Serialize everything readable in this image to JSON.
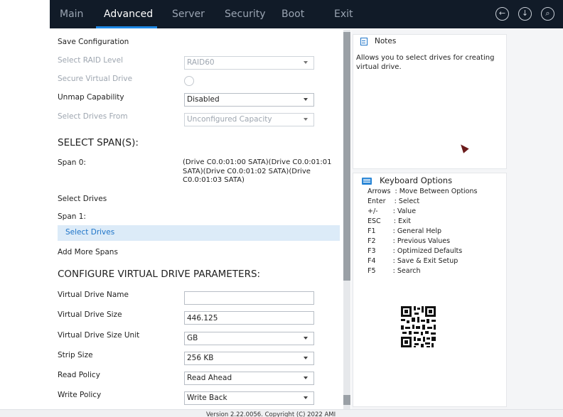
{
  "tabs": [
    {
      "label": "Main",
      "active": false
    },
    {
      "label": "Advanced",
      "active": true
    },
    {
      "label": "Server",
      "active": false
    },
    {
      "label": "Security",
      "active": false
    },
    {
      "label": "Boot",
      "active": false
    },
    {
      "label": "Exit",
      "active": false
    }
  ],
  "top_icons": [
    "back-circle-icon",
    "download-circle-icon",
    "search-circle-icon"
  ],
  "form": {
    "save_configuration": "Save Configuration",
    "select_raid_level": {
      "label": "Select RAID Level",
      "value": "RAID60"
    },
    "secure_virtual_drive": {
      "label": "Secure Virtual Drive"
    },
    "unmap_capability": {
      "label": "Unmap Capability",
      "value": "Disabled"
    },
    "select_drives_from": {
      "label": "Select Drives From",
      "value": "Unconfigured Capacity"
    },
    "select_spans_heading": "SELECT SPAN(S):",
    "span0": {
      "label": "Span 0:",
      "value": "(Drive C0.0:01:00 SATA)(Drive C0.0:01:01 SATA)(Drive C0.0:01:02 SATA)(Drive C0.0:01:03 SATA)"
    },
    "select_drives_1": "Select Drives",
    "span1": {
      "label": "Span 1:"
    },
    "select_drives_2": "Select Drives",
    "add_more_spans": "Add More Spans",
    "configure_heading": "CONFIGURE VIRTUAL DRIVE PARAMETERS:",
    "virtual_drive_name": {
      "label": "Virtual Drive Name",
      "value": ""
    },
    "virtual_drive_size": {
      "label": "Virtual Drive Size",
      "value": "446.125"
    },
    "virtual_drive_size_unit": {
      "label": "Virtual Drive Size Unit",
      "value": "GB"
    },
    "strip_size": {
      "label": "Strip Size",
      "value": "256 KB"
    },
    "read_policy": {
      "label": "Read Policy",
      "value": "Read Ahead"
    },
    "write_policy": {
      "label": "Write Policy",
      "value": "Write Back"
    }
  },
  "notes": {
    "title": "Notes",
    "text": "Allows you to select drives for creating virtual drive."
  },
  "keyboard": {
    "title": "Keyboard Options",
    "lines": [
      "Arrows  : Move Between Options",
      "Enter    : Select",
      "+/-       : Value",
      "ESC      : Exit",
      "F1        : General Help",
      "F2        : Previous Values",
      "F3        : Optimized Defaults",
      "F4        : Save & Exit Setup",
      "F5        : Search"
    ]
  },
  "footer": {
    "text": "Version 2.22.0056. Copyright (C) 2022 AMI"
  }
}
